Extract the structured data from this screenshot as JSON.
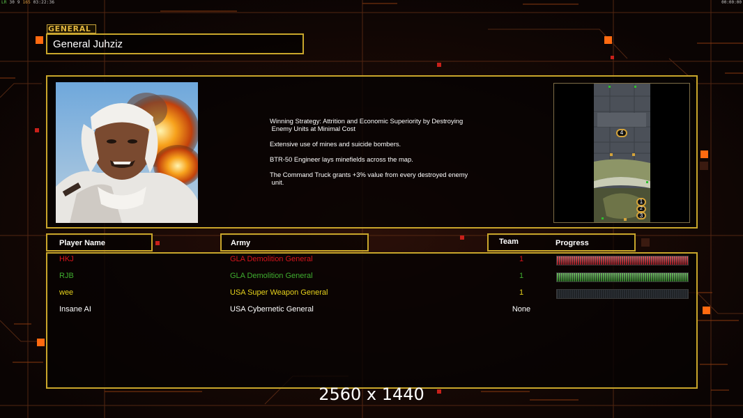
{
  "hud": {
    "top_left_a": "LR",
    "top_left_b": "30 9",
    "top_left_c": "165",
    "top_left_d": "03:22:36",
    "top_right": "00:00:00"
  },
  "general": {
    "tag": "GENERAL",
    "name": "General Juhziz"
  },
  "description": [
    "Winning Strategy: Attrition and Economic Superiority by Destroying\n Enemy Units at Minimal Cost",
    "Extensive use of mines and suicide bombers.",
    "BTR-50 Engineer lays minefields across the map.",
    "The Command Truck grants +3% value from every destroyed enemy\n unit."
  ],
  "minimap": {
    "markers": [
      "4",
      "1",
      "2",
      "3"
    ]
  },
  "table": {
    "headers": {
      "player": "Player Name",
      "army": "Army",
      "team": "Team",
      "progress": "Progress"
    },
    "rows": [
      {
        "name": "HKJ",
        "army": "GLA Demolition General",
        "team": "1",
        "color": "#d8141c",
        "progress": 1.0,
        "bar_color": "#c8202a"
      },
      {
        "name": "RJB",
        "army": "GLA Demolition General",
        "team": "1",
        "color": "#3fae2f",
        "progress": 1.0,
        "bar_color": "#3ea32e"
      },
      {
        "name": "wee",
        "army": "USA Super Weapon General",
        "team": "1",
        "color": "#e6d21c",
        "progress": 0.0,
        "bar_color": "#3a3a3a"
      },
      {
        "name": "Insane AI",
        "army": "USA Cybernetic General",
        "team": "None",
        "color": "#ffffff",
        "progress": null,
        "bar_color": ""
      }
    ]
  },
  "resolution_label": "2560 x 1440",
  "colors": {
    "frame_gold": "#c9a62b",
    "accent_orange": "#ff6a00",
    "background": "#0d0605"
  }
}
